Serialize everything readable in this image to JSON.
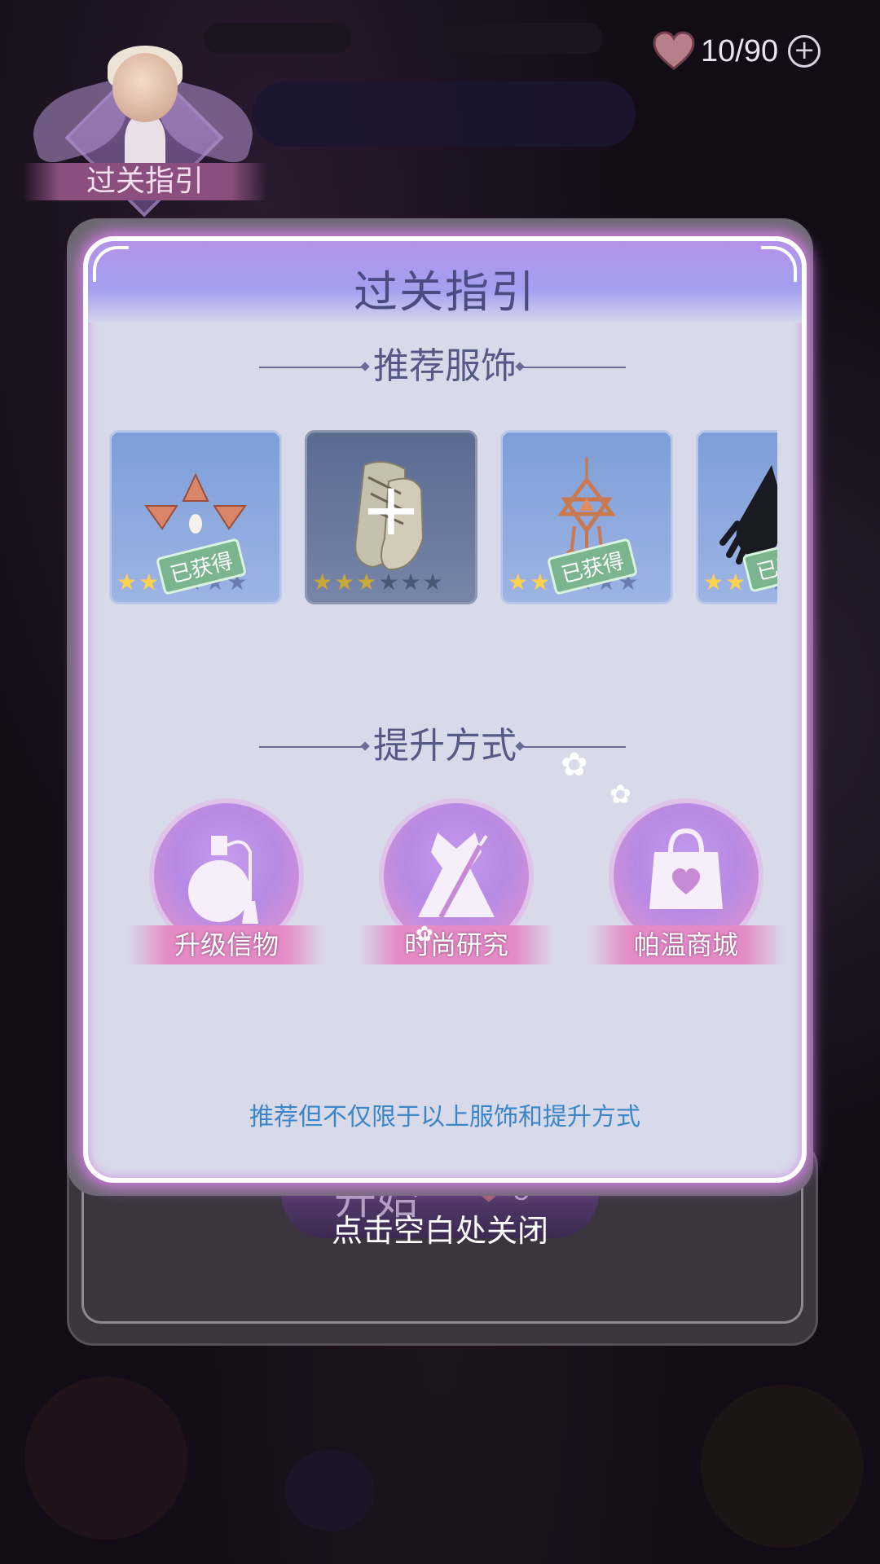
{
  "hud": {
    "energy": "10/90",
    "add_symbol": "+"
  },
  "guide_badge": {
    "label": "过关指引"
  },
  "dialog": {
    "title": "过关指引",
    "outfits_section": "推荐服饰",
    "methods_section": "提升方式",
    "footnote": "推荐但不仅限于以上服饰和提升方式"
  },
  "outfits": [
    {
      "item": "triangle-hair-accessory",
      "stars_on": 2,
      "stars_total": 6,
      "obtained_label": "已获得",
      "owned": true
    },
    {
      "item": "pointed-shoes",
      "stars_on": 3,
      "stars_total": 6,
      "obtained_label": "",
      "owned": false,
      "add_symbol": "+"
    },
    {
      "item": "star-pendant-necklace",
      "stars_on": 2,
      "stars_total": 6,
      "obtained_label": "已获得",
      "owned": true
    },
    {
      "item": "black-glove",
      "stars_on": 2,
      "stars_total": 6,
      "obtained_label": "已获",
      "owned": true
    }
  ],
  "methods": [
    {
      "label": "升级信物",
      "icon": "perfume-bottle-icon"
    },
    {
      "label": "时尚研究",
      "icon": "dress-needle-icon"
    },
    {
      "label": "帕温商城",
      "icon": "shopping-bag-icon"
    }
  ],
  "background": {
    "start_label": "开始",
    "start_cost": "5",
    "close_hint": "点击空白处关闭"
  },
  "colors": {
    "dialog_bg": "#d8d9e9",
    "title": "#4a4b80",
    "footnote": "#3b86c7",
    "glow": "#d07be0",
    "star_on": "#ffd34d"
  }
}
